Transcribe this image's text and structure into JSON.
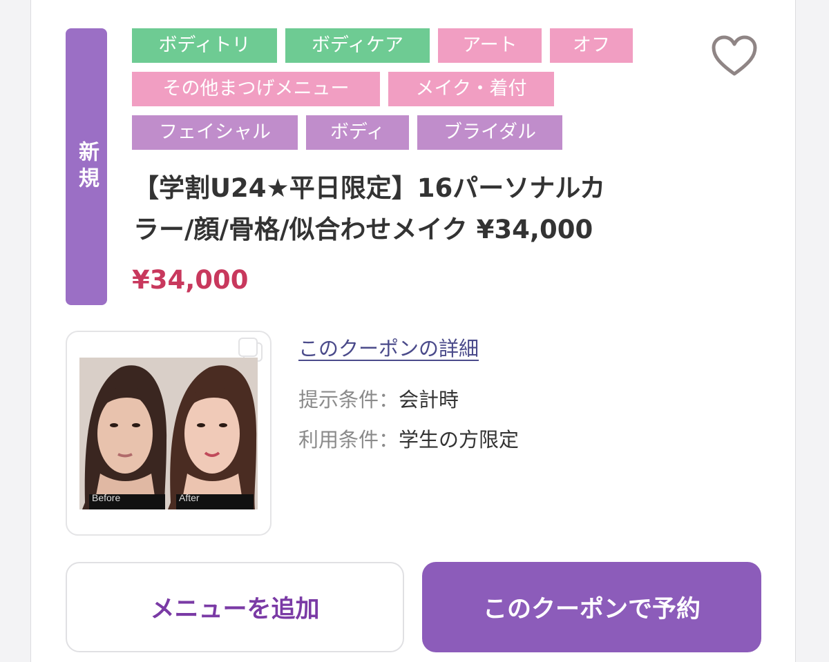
{
  "badge": {
    "label": "新規"
  },
  "tags": [
    {
      "label": "ボディトリ",
      "color": "#6ecb93"
    },
    {
      "label": "ボディケア",
      "color": "#6ecb93"
    },
    {
      "label": "アート",
      "color": "#f19ec2"
    },
    {
      "label": "オフ",
      "color": "#f19ec2"
    },
    {
      "label": "その他まつげメニュー",
      "color": "#f19ec2"
    },
    {
      "label": "メイク・着付",
      "color": "#f19ec2"
    },
    {
      "label": "フェイシャル",
      "color": "#c08dcb"
    },
    {
      "label": "ボディ",
      "color": "#c08dcb"
    },
    {
      "label": "ブライダル",
      "color": "#c08dcb"
    }
  ],
  "favorite": {
    "icon": "heart-outline-icon"
  },
  "coupon": {
    "title_line1": "【学割U24★平日限定】16パーソナルカ",
    "title_line2": "ラー/顔/骨格/似合わせメイク ¥34,000",
    "price": "¥34,000",
    "image": {
      "before_label": "Before",
      "after_label": "After"
    },
    "detail_link": "このクーポンの詳細",
    "conditions": [
      {
        "label": "提示条件：",
        "value": "会計時"
      },
      {
        "label": "利用条件：",
        "value": "学生の方限定"
      }
    ]
  },
  "actions": {
    "add_menu": "メニューを追加",
    "reserve": "このクーポンで予約"
  },
  "colors": {
    "accent": "#8c5cba",
    "badge": "#9b6fc5",
    "price": "#c8385d"
  }
}
